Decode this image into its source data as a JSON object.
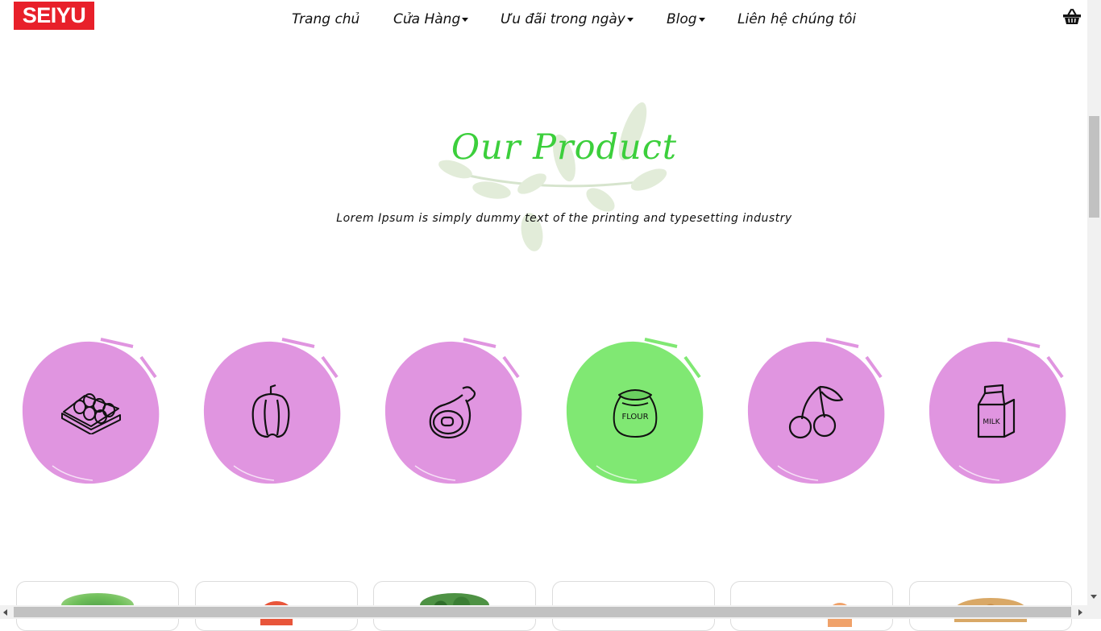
{
  "logo": {
    "text": "SEIYU",
    "color": "#e8202a"
  },
  "nav": {
    "items": [
      {
        "label": "Trang chủ",
        "dropdown": false
      },
      {
        "label": "Cửa Hàng",
        "dropdown": true
      },
      {
        "label": "Ưu đãi trong ngày",
        "dropdown": true
      },
      {
        "label": "Blog",
        "dropdown": true
      },
      {
        "label": "Liên hệ chúng tôi",
        "dropdown": false
      }
    ],
    "cart_icon": "basket-icon"
  },
  "section": {
    "title": "Our Product",
    "subtitle": "Lorem Ipsum is simply dummy text of the printing and typesetting industry",
    "title_color": "#3ccf3c",
    "background_icon": "leaf-branch-icon"
  },
  "categories": [
    {
      "icon": "eggs-icon",
      "active": false
    },
    {
      "icon": "bell-pepper-icon",
      "active": false
    },
    {
      "icon": "ham-icon",
      "active": false
    },
    {
      "icon": "flour-sack-icon",
      "active": true,
      "label": "FLOUR"
    },
    {
      "icon": "cherries-icon",
      "active": false
    },
    {
      "icon": "milk-carton-icon",
      "active": false,
      "label": "MILK"
    }
  ],
  "category_colors": {
    "default": "#e095e0",
    "active": "#80e873"
  },
  "products": [
    {
      "image": "watermelon-image"
    },
    {
      "image": "tomato-image"
    },
    {
      "image": "broccoli-image"
    },
    {
      "image": "product-image"
    },
    {
      "image": "shrimp-image"
    },
    {
      "image": "nuts-image"
    }
  ]
}
